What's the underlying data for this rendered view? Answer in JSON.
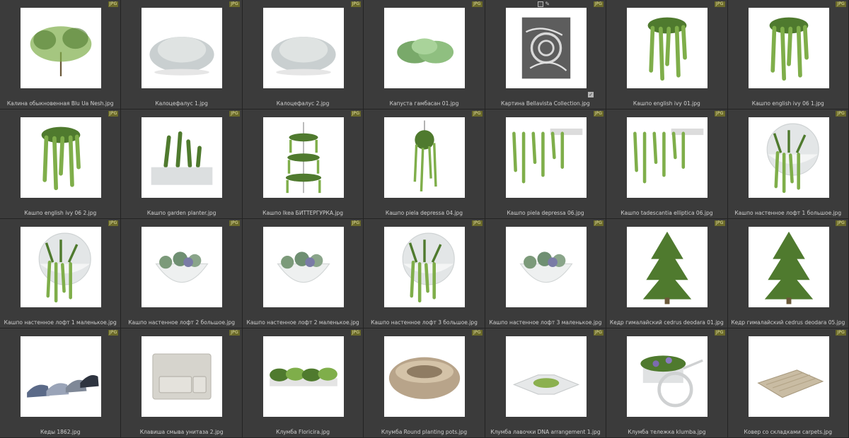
{
  "badge_label": "JPG",
  "items": [
    {
      "name": "Калина обыкновенная Blu Ua Nesh.jpg",
      "icon": "shrub-thumbnail"
    },
    {
      "name": "Калоцефалус 1.jpg",
      "icon": "silver-bush-thumbnail"
    },
    {
      "name": "Калоцефалус 2.jpg",
      "icon": "silver-bush-thumbnail"
    },
    {
      "name": "Капуста гамбасан 01.jpg",
      "icon": "cabbage-thumbnail"
    },
    {
      "name": "Картина Bellavista Collection.jpg",
      "icon": "painting-thumbnail"
    },
    {
      "name": "Кашпо english ivy 01.jpg",
      "icon": "hanging-ivy-thumbnail"
    },
    {
      "name": "Кашпо english ivy 06 1.jpg",
      "icon": "hanging-ivy-thumbnail"
    },
    {
      "name": "Кашпо english ivy 06 2.jpg",
      "icon": "hanging-ivy-thumbnail"
    },
    {
      "name": "Кашпо garden planter.jpg",
      "icon": "planter-box-thumbnail"
    },
    {
      "name": "Кашпо Ikea БИТТЕРГУРКА.jpg",
      "icon": "tiered-planter-thumbnail"
    },
    {
      "name": "Кашпо piela depressa 04.jpg",
      "icon": "hanging-basket-thumbnail"
    },
    {
      "name": "Кашпо piela depressa 06.jpg",
      "icon": "wall-trailing-plant-thumbnail"
    },
    {
      "name": "Кашпо tadescantia elliptica 06.jpg",
      "icon": "wall-trailing-plant-thumbnail"
    },
    {
      "name": "Кашпо настенное лофт 1 большое.jpg",
      "icon": "wall-bowl-planter-thumbnail"
    },
    {
      "name": "Кашпо настенное лофт 1 маленькое.jpg",
      "icon": "wall-bowl-planter-thumbnail"
    },
    {
      "name": "Кашпо настенное лофт 2 большое.jpg",
      "icon": "half-bowl-succulents-thumbnail"
    },
    {
      "name": "Кашпо настенное лофт 2 маленькое.jpg",
      "icon": "half-bowl-succulents-thumbnail"
    },
    {
      "name": "Кашпо настенное лофт 3 большое.jpg",
      "icon": "wall-bowl-planter-thumbnail"
    },
    {
      "name": "Кашпо настенное лофт 3 маленькое.jpg",
      "icon": "half-bowl-succulents-thumbnail"
    },
    {
      "name": "Кедр гималайский cedrus deodara 01.jpg",
      "icon": "conifer-tree-thumbnail"
    },
    {
      "name": "Кедр гималайский cedrus deodara 05.jpg",
      "icon": "conifer-tree-thumbnail"
    },
    {
      "name": "Кеды 1862.jpg",
      "icon": "sneakers-thumbnail"
    },
    {
      "name": "Клавиша смыва унитаза 2.jpg",
      "icon": "flush-plate-thumbnail"
    },
    {
      "name": "Клумба Floricira.jpg",
      "icon": "flower-bed-thumbnail"
    },
    {
      "name": "Клумба Round planting pots.jpg",
      "icon": "round-pots-thumbnail"
    },
    {
      "name": "Клумба лавочки DNA arrangement 1.jpg",
      "icon": "bench-planter-thumbnail"
    },
    {
      "name": "Клумба тележка klumba.jpg",
      "icon": "flower-cart-thumbnail"
    },
    {
      "name": "Ковер со складками carpets.jpg",
      "icon": "carpet-thumbnail"
    }
  ],
  "colors": {
    "background": "#2b2b2b",
    "cell": "#3b3b3b",
    "badge": "#6b6a2a",
    "caption": "#cfcfcf"
  }
}
